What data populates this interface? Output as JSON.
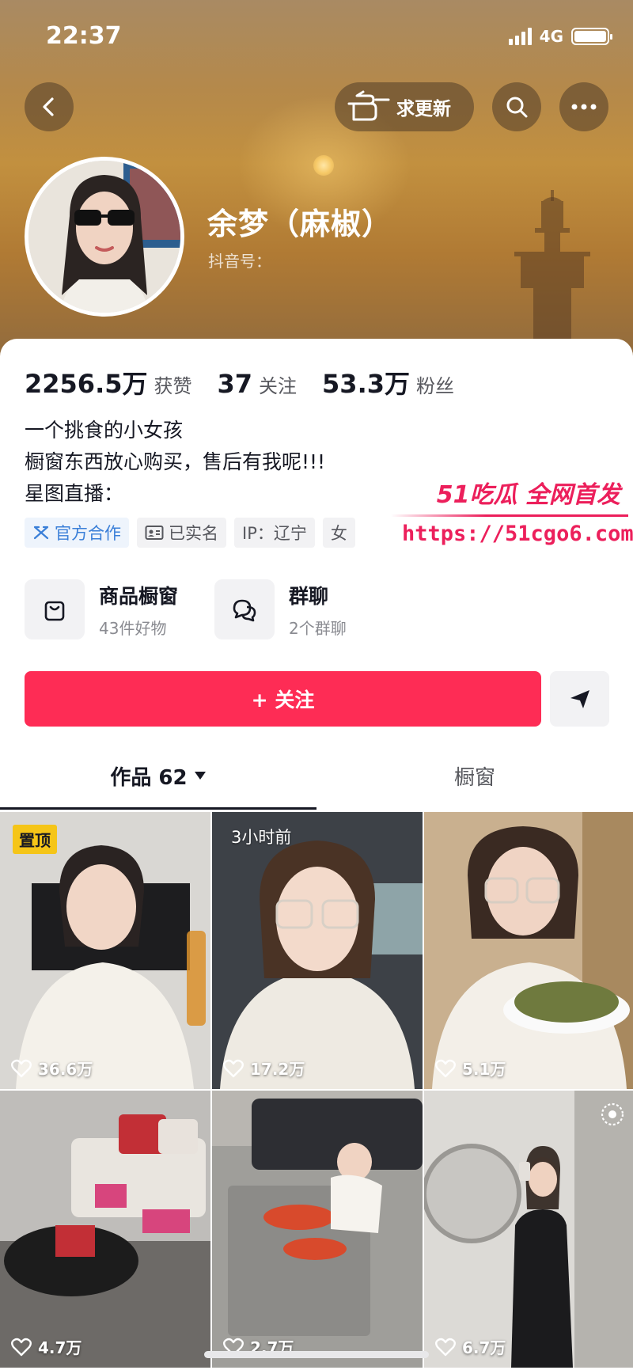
{
  "status_bar": {
    "time": "22:37",
    "network": "4G"
  },
  "header": {
    "update_label": "求更新",
    "nickname": "余梦（麻椒）",
    "douyin_id_label": "抖音号："
  },
  "stats": [
    {
      "value": "2256.5万",
      "label": "获赞"
    },
    {
      "value": "37",
      "label": "关注"
    },
    {
      "value": "53.3万",
      "label": "粉丝"
    }
  ],
  "bio": {
    "line1": "一个挑食的小女孩",
    "line2": "橱窗东西放心购买，售后有我呢!!!",
    "line3": "星图直播："
  },
  "tags": {
    "official": "官方合作",
    "verified": "已实名",
    "ip": "IP：辽宁",
    "gender": "女"
  },
  "watermark": {
    "brand": "51吃瓜 全网首发",
    "url": "https://51cgo6.com"
  },
  "entries": {
    "shop": {
      "title": "商品橱窗",
      "sub": "43件好物"
    },
    "group": {
      "title": "群聊",
      "sub": "2个群聊"
    }
  },
  "follow_label": "+ 关注",
  "tabs": {
    "works": "作品 62",
    "window": "橱窗"
  },
  "videos": [
    {
      "badge": "置顶",
      "likes": "36.6万"
    },
    {
      "time": "3小时前",
      "likes": "17.2万"
    },
    {
      "likes": "5.1万"
    },
    {
      "likes": "4.7万"
    },
    {
      "likes": "2.7万"
    },
    {
      "likes": "6.7万"
    }
  ],
  "colors": {
    "accent": "#fe2c55",
    "text": "#161823",
    "watermark": "#ec1f5b"
  }
}
